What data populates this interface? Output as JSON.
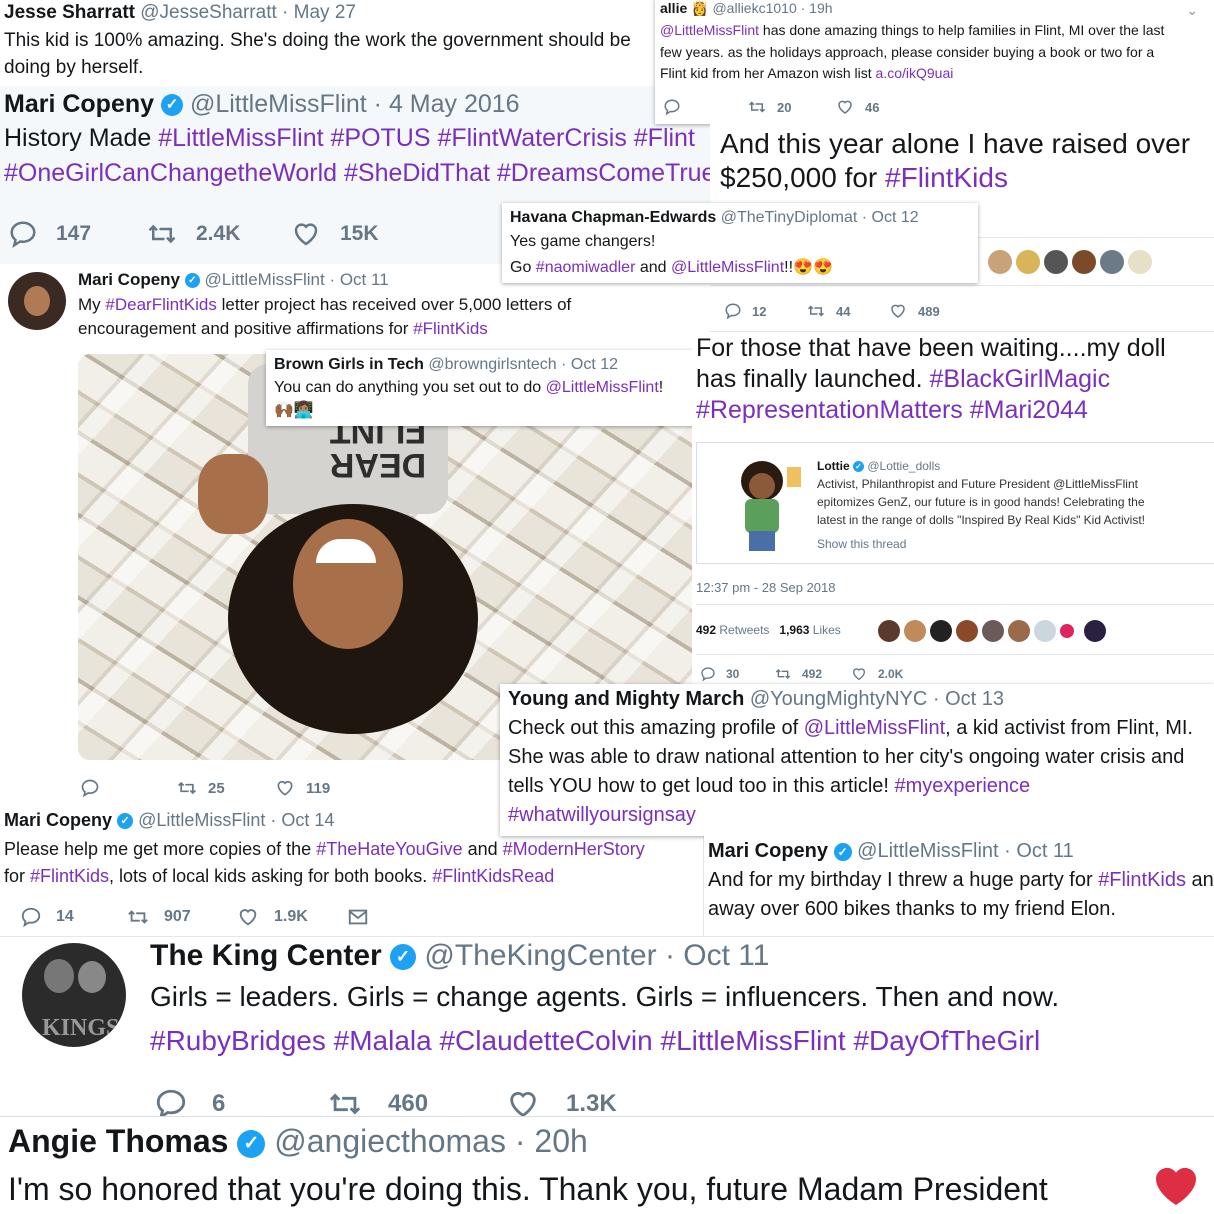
{
  "t1": {
    "name": "Jesse Sharratt",
    "handle": "@JesseSharratt · May 27",
    "line1": "This kid is 100% amazing. She's doing the work the government should be",
    "line2": "doing by herself."
  },
  "t2": {
    "name": "allie",
    "badge_emoji": "👸",
    "handle": "@alliekc1010 · 19h",
    "mention": "@LittleMissFlint",
    "line1_rest": " has done amazing things to help families in Flint, MI over the last",
    "line2": "few years. as the holidays approach, please consider buying a book or two for a",
    "line3_pre": "Flint kid from her Amazon wish list ",
    "line3_link": "a.co/ikQ9uai",
    "retweets": "20",
    "likes": "46"
  },
  "t3": {
    "name": "Mari Copeny",
    "handle": "@LittleMissFlint · 4 May 2016",
    "line1_pre": "History Made ",
    "line1_tags": "#LittleMissFlint #POTUS #FlintWaterCrisis #Flint",
    "line2_tags": "#OneGirlCanChangetheWorld #SheDidThat #DreamsComeTrue",
    "replies": "147",
    "retweets": "2.4K",
    "likes": "15K"
  },
  "t4": {
    "line1": "And this year alone I have raised over",
    "line2_pre": "$250,000 for ",
    "line2_tag": "#FlintKids",
    "replies": "12",
    "retweets": "44",
    "likes": "489"
  },
  "t5": {
    "name": "Havana Chapman-Edwards",
    "handle": "@TheTinyDiplomat · Oct 12",
    "line1": "Yes game changers!",
    "line2_pre": "Go ",
    "line2_m1": "#naomiwadler",
    "line2_mid": " and ",
    "line2_m2": "@LittleMissFlint",
    "line2_end": "!!😍😍"
  },
  "t6": {
    "name": "Mari Copeny",
    "handle": "@LittleMissFlint · Oct 11",
    "line1_pre": "My ",
    "line1_tag": "#DearFlintKids",
    "line1_rest": " letter project has received over 5,000 letters of",
    "line2_pre": "encouragement and positive affirmations for ",
    "line2_tag": "#FlintKids",
    "photo_shirt": "DEAR FLINT",
    "retweets": "25",
    "likes": "119"
  },
  "t7": {
    "name": "Brown Girls in Tech",
    "handle": "@browngirlsntech · Oct 12",
    "line1_pre": "You can do anything you set out to do ",
    "line1_mention": "@LittleMissFlint",
    "line1_end": "!",
    "emoji": "🙌🏾👩🏽‍💻"
  },
  "t8": {
    "line1": "For those that have been waiting....my doll",
    "line2_pre": "has finally launched. ",
    "line2_tag": "#BlackGirlMagic",
    "line3": "#RepresentationMatters #Mari2044"
  },
  "t9": {
    "name": "Lottie",
    "handle": "@Lottie_dolls",
    "line1": "Activist, Philanthropist and Future President @LittleMissFlint",
    "line2": "epitomizes GenZ, our future is in good hands!  Celebrating the",
    "line3": "latest in the range of dolls \"Inspired By Real Kids\" Kid Activist!",
    "thread_link": "Show this thread",
    "timestamp": "12:37 pm - 28 Sep 2018",
    "retweets_count": "492",
    "retweets_label": "Retweets",
    "likes_count": "1,963",
    "likes_label": "Likes",
    "replies": "30",
    "retweets": "492",
    "likes": "2.0K"
  },
  "t10": {
    "name": "Young and Mighty March",
    "handle": "@YoungMightyNYC · Oct 13",
    "line1_pre": "Check out this amazing profile of ",
    "line1_mention": "@LittleMissFlint",
    "line1_rest": ", a kid activist from Flint, MI.",
    "line2": "She was able to draw national attention to her city's ongoing water crisis and",
    "line3_pre": "tells YOU how to get loud too in this article! ",
    "line3_tag": "#myexperience",
    "line4_tag": "#whatwillyoursignsay"
  },
  "t11": {
    "name": "Mari Copeny",
    "handle": "@LittleMissFlint · Oct 14",
    "line1_pre": "Please help me get more copies of the ",
    "line1_tag1": "#TheHateYouGive",
    "line1_mid": " and ",
    "line1_tag2": "#ModernHerStory",
    "line2_pre": "for ",
    "line2_tag1": "#FlintKids",
    "line2_mid": ", lots of local kids asking for both books. ",
    "line2_tag2": "#FlintKidsRead",
    "replies": "14",
    "retweets": "907",
    "likes": "1.9K"
  },
  "t12": {
    "name": "Mari Copeny",
    "handle": "@LittleMissFlint · Oct 11",
    "line1_pre": "And for my birthday I threw a huge party for ",
    "line1_tag": "#FlintKids",
    "line1_cut": " an",
    "line2": "away over 600 bikes thanks to my friend Elon."
  },
  "t13": {
    "name": "The King Center",
    "handle": "@TheKingCenter · Oct 11",
    "line1": "Girls = leaders. Girls = change agents. Girls = influencers. Then and now.",
    "line2_tags": "#RubyBridges #Malala #ClaudetteColvin #LittleMissFlint #DayOfTheGirl",
    "avatar_text": "KINGS",
    "replies": "6",
    "retweets": "460",
    "likes": "1.3K"
  },
  "t14": {
    "name": "Angie Thomas",
    "handle": "@angiecthomas · 20h",
    "line1": "I'm so honored that you're doing this. Thank you, future Madam President"
  },
  "colors": {
    "hashtag": "#7b2fbe",
    "verified": "#1da1f2",
    "muted": "#657786",
    "heart": "#e0245e"
  },
  "icons": {
    "reply": "reply-icon",
    "retweet": "retweet-icon",
    "like": "heart-icon",
    "message": "envelope-icon",
    "verified": "verified-badge-icon",
    "chevron": "chevron-down-icon"
  }
}
